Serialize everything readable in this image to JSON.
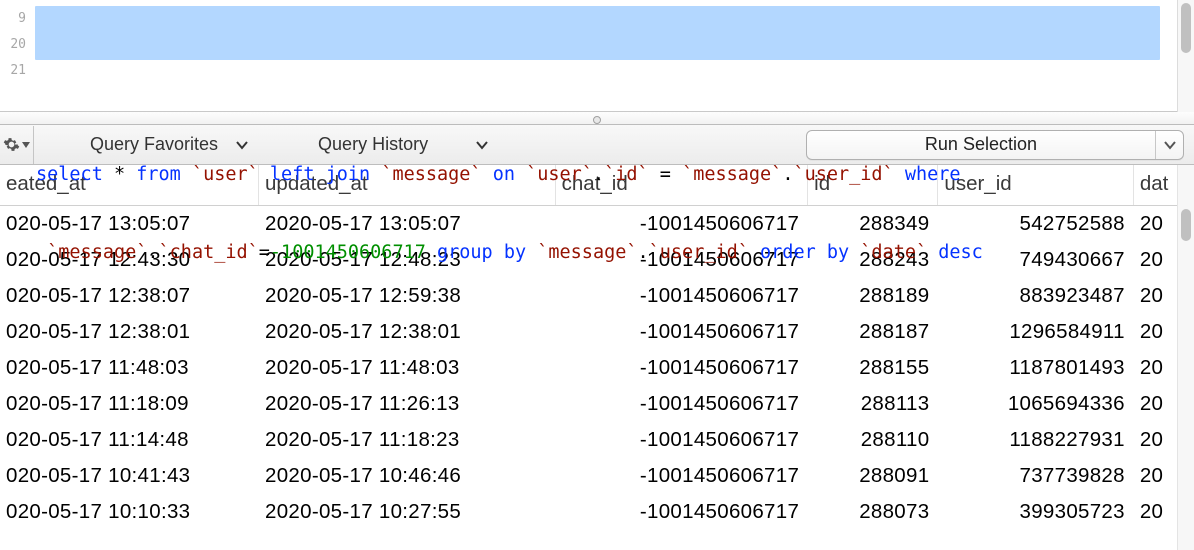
{
  "editor": {
    "line_numbers": [
      "9",
      "20",
      "21"
    ],
    "sql_tokens_line1": [
      {
        "t": "select",
        "c": "kw"
      },
      {
        "t": " ",
        "c": "op"
      },
      {
        "t": "*",
        "c": "star"
      },
      {
        "t": " ",
        "c": "op"
      },
      {
        "t": "from",
        "c": "kw"
      },
      {
        "t": " ",
        "c": "op"
      },
      {
        "t": "`user`",
        "c": "ident"
      },
      {
        "t": " ",
        "c": "op"
      },
      {
        "t": "left join",
        "c": "kw"
      },
      {
        "t": " ",
        "c": "op"
      },
      {
        "t": "`message`",
        "c": "ident"
      },
      {
        "t": " ",
        "c": "op"
      },
      {
        "t": "on",
        "c": "kw"
      },
      {
        "t": " ",
        "c": "op"
      },
      {
        "t": "`user`",
        "c": "ident"
      },
      {
        "t": ".",
        "c": "punct"
      },
      {
        "t": "`id`",
        "c": "ident"
      },
      {
        "t": " = ",
        "c": "op"
      },
      {
        "t": "`message`",
        "c": "ident"
      },
      {
        "t": ".",
        "c": "punct"
      },
      {
        "t": "`user_id`",
        "c": "ident"
      },
      {
        "t": " ",
        "c": "op"
      },
      {
        "t": "where",
        "c": "kw"
      }
    ],
    "sql_tokens_line2": [
      {
        "t": " ",
        "c": "op"
      },
      {
        "t": "`message`",
        "c": "ident"
      },
      {
        "t": ".",
        "c": "punct"
      },
      {
        "t": "`chat_id`",
        "c": "ident"
      },
      {
        "t": "=",
        "c": "op"
      },
      {
        "t": "-1001450606717",
        "c": "num"
      },
      {
        "t": " ",
        "c": "op"
      },
      {
        "t": "group by",
        "c": "kw"
      },
      {
        "t": " ",
        "c": "op"
      },
      {
        "t": "`message`",
        "c": "ident"
      },
      {
        "t": ".",
        "c": "punct"
      },
      {
        "t": "`user_id`",
        "c": "ident"
      },
      {
        "t": " ",
        "c": "op"
      },
      {
        "t": "order by",
        "c": "kw"
      },
      {
        "t": " ",
        "c": "op"
      },
      {
        "t": "`date`",
        "c": "ident"
      },
      {
        "t": " ",
        "c": "op"
      },
      {
        "t": "desc",
        "c": "kw"
      }
    ]
  },
  "toolbar": {
    "favorites_label": "Query Favorites",
    "history_label": "Query History",
    "run_label": "Run Selection"
  },
  "columns": {
    "c0": "eated_at",
    "c1": "updated_at",
    "c2": "chat_id",
    "c3": "id",
    "c4": "user_id",
    "c5": "dat"
  },
  "rows": [
    {
      "created": "020-05-17 13:05:07",
      "updated": "2020-05-17 13:05:07",
      "chat": "-1001450606717",
      "id": "288349",
      "user": "542752588",
      "date": "20"
    },
    {
      "created": "020-05-17 12:43:30",
      "updated": "2020-05-17 12:48:23",
      "chat": "-1001450606717",
      "id": "288243",
      "user": "749430667",
      "date": "20"
    },
    {
      "created": "020-05-17 12:38:07",
      "updated": "2020-05-17 12:59:38",
      "chat": "-1001450606717",
      "id": "288189",
      "user": "883923487",
      "date": "20"
    },
    {
      "created": "020-05-17 12:38:01",
      "updated": "2020-05-17 12:38:01",
      "chat": "-1001450606717",
      "id": "288187",
      "user": "1296584911",
      "date": "20"
    },
    {
      "created": "020-05-17 11:48:03",
      "updated": "2020-05-17 11:48:03",
      "chat": "-1001450606717",
      "id": "288155",
      "user": "1187801493",
      "date": "20"
    },
    {
      "created": "020-05-17 11:18:09",
      "updated": "2020-05-17 11:26:13",
      "chat": "-1001450606717",
      "id": "288113",
      "user": "1065694336",
      "date": "20"
    },
    {
      "created": "020-05-17 11:14:48",
      "updated": "2020-05-17 11:18:23",
      "chat": "-1001450606717",
      "id": "288110",
      "user": "1188227931",
      "date": "20"
    },
    {
      "created": "020-05-17 10:41:43",
      "updated": "2020-05-17 10:46:46",
      "chat": "-1001450606717",
      "id": "288091",
      "user": "737739828",
      "date": "20"
    },
    {
      "created": "020-05-17 10:10:33",
      "updated": "2020-05-17 10:27:55",
      "chat": "-1001450606717",
      "id": "288073",
      "user": "399305723",
      "date": "20"
    }
  ]
}
